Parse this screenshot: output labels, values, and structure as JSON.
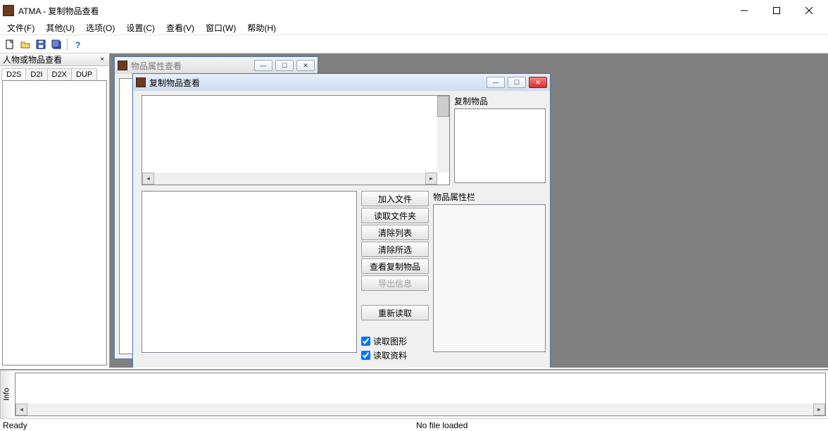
{
  "title": "ATMA - 复制物品查看",
  "menu": {
    "file": "文件(F)",
    "other": "其他(U)",
    "options": "选项(O)",
    "settings": "设置(C)",
    "view": "查看(V)",
    "window": "窗口(W)",
    "help": "帮助(H)"
  },
  "left_panel": {
    "title": "人物或物品查看",
    "tabs": {
      "d2s": "D2S",
      "d2i": "D2I",
      "d2x": "D2X",
      "dup": "DUP"
    }
  },
  "info_tab": "Info",
  "child_windows": {
    "item_prop": {
      "title": "物品属性查看"
    },
    "dupe": {
      "title": "复制物品查看",
      "labels": {
        "dup_items": "复制物品",
        "item_props": "物品属性栏"
      },
      "buttons": {
        "add_file": "加入文件",
        "read_folder": "读取文件夹",
        "clear_list": "清除列表",
        "clear_sel": "清除所选",
        "view_dupes": "查看复制物品",
        "export_info": "导出信息",
        "reread": "重新读取"
      },
      "checks": {
        "read_graphic": "读取图形",
        "read_data": "读取资料"
      }
    }
  },
  "status": {
    "ready": "Ready",
    "nofile": "No file loaded"
  }
}
